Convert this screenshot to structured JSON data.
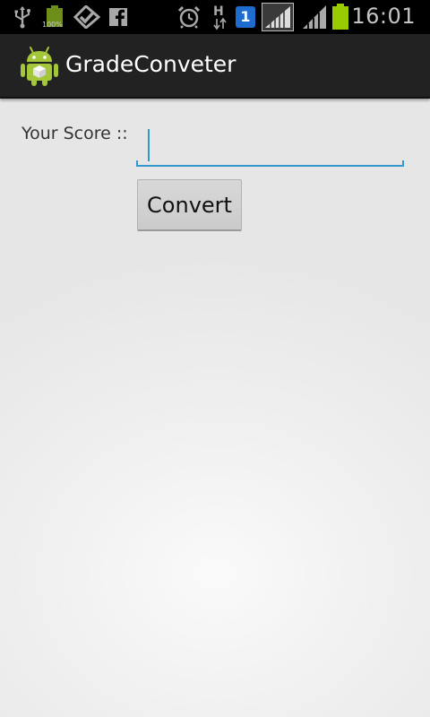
{
  "status_bar": {
    "icons": [
      "usb-icon",
      "battery-charging-icon",
      "checklist-app-icon",
      "facebook-icon",
      "alarm-icon",
      "hspa-data-icon",
      "sim-1-badge-icon",
      "wifi-signal-icon",
      "cell-signal-icon",
      "battery-icon"
    ],
    "battery_small_label": "100%",
    "hspa_label": "H",
    "sim_label": "1",
    "time": "16:01",
    "battery_color": "#99cc00"
  },
  "action_bar": {
    "title": "GradeConveter",
    "icon": "android-robot-icon"
  },
  "form": {
    "score_label": "Your Score ::",
    "score_value": "",
    "score_placeholder": "",
    "convert_label": "Convert"
  },
  "colors": {
    "accent": "#3399cc",
    "action_bar": "#222222",
    "android_green": "#a4c639"
  }
}
